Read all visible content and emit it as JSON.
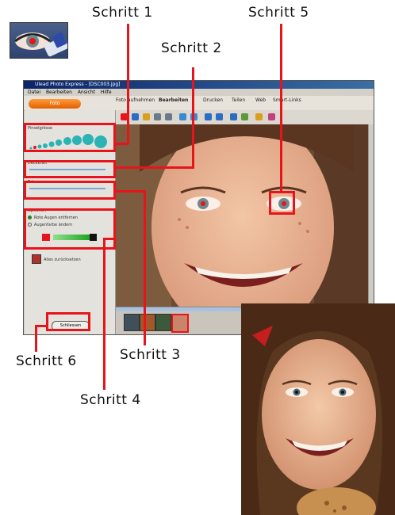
{
  "callouts": {
    "step1": "Schritt 1",
    "step2": "Schritt 2",
    "step3": "Schritt 3",
    "step4": "Schritt 4",
    "step5": "Schritt 5",
    "step6": "Schritt 6"
  },
  "window": {
    "title": "Ulead Photo Express - [DSC003.jpg]",
    "menu": [
      "Datei",
      "Bearbeiten",
      "Ansicht",
      "Hilfe"
    ],
    "foto_button": "Foto",
    "tabs": [
      "Foto aufnehmen",
      "Bearbeiten",
      "Drucken",
      "Teilen",
      "Web",
      "Smart-Links"
    ]
  },
  "sidebar": {
    "brush_size_label": "Pinselgrösse",
    "opacity_label": "Deckkraft",
    "tolerance_label": "Toleranz",
    "options_label": "Optionen",
    "option_1": "Rote Augen entfernen",
    "option_2": "Augenfarbe ändern",
    "apply_all_label": "Alles zurücksetzen",
    "finish_button": "Schliessen"
  },
  "colors": {
    "callout_red": "#e8141b",
    "brush_dots": "#2bb3b5",
    "toolbar_orange": "#e06000"
  }
}
